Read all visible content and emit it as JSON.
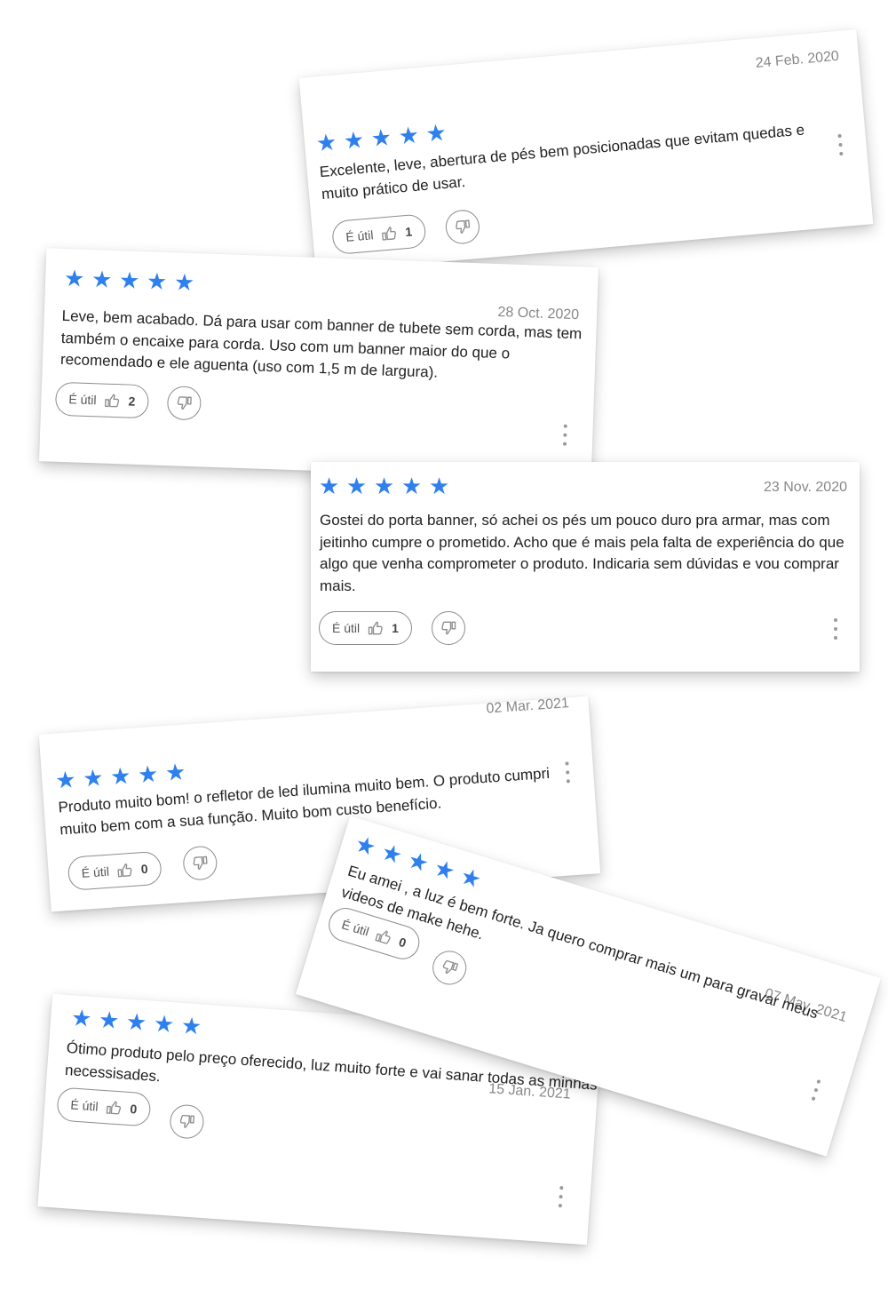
{
  "helpful_label": "É útil",
  "colors": {
    "star": "#2f80ed",
    "border": "#8c8c8c",
    "date": "#888888"
  },
  "icons": {
    "star": "star-icon",
    "like": "thumbs-up-icon",
    "dislike": "thumbs-down-icon",
    "menu": "more-vertical-icon"
  },
  "reviews": [
    {
      "rating": 5,
      "date": "24 Feb. 2020",
      "text": "Excelente, leve, abertura de pés bem posicionadas que evitam quedas e muito prático de usar.",
      "helpful_count": "1"
    },
    {
      "rating": 5,
      "date": "28 Oct. 2020",
      "text": "Leve, bem acabado. Dá para usar com banner de tubete sem corda, mas tem também o encaixe para corda. Uso com um banner maior do que o recomendado e ele aguenta (uso com 1,5 m de largura).",
      "helpful_count": "2"
    },
    {
      "rating": 5,
      "date": "23 Nov. 2020",
      "text": "Gostei do porta banner, só achei os pés um pouco duro pra armar, mas com jeitinho cumpre o prometido. Acho que é mais pela falta de experiência do que algo que venha comprometer o produto. Indicaria sem dúvidas e vou comprar mais.",
      "helpful_count": "1"
    },
    {
      "rating": 5,
      "date": "02 Mar. 2021",
      "text": "Produto muito bom! o refletor de led ilumina muito bem. O produto cumpri muito bem com a sua função. Muito bom custo benefício.",
      "helpful_count": "0"
    },
    {
      "rating": 5,
      "date": "15 Jan. 2021",
      "text": "Ótimo produto pelo preço oferecido, luz muito forte e vai sanar todas as minhas necessisades.",
      "helpful_count": "0"
    },
    {
      "rating": 5,
      "date": "07 May. 2021",
      "text": "Eu amei , a luz é bem forte. Ja quero comprar mais um para gravar meus videos de make hehe.",
      "helpful_count": "0"
    }
  ]
}
